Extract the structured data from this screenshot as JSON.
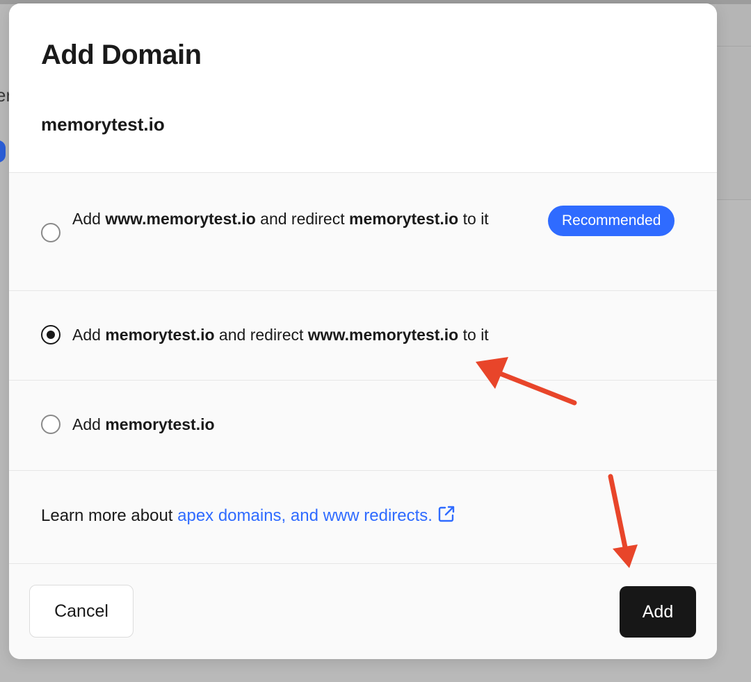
{
  "background": {
    "partial_text": "er"
  },
  "modal": {
    "title": "Add Domain",
    "domain": "memorytest.io"
  },
  "options": [
    {
      "selected": false,
      "parts": [
        {
          "text": "Add ",
          "bold": false
        },
        {
          "text": "www.memorytest.io",
          "bold": true
        },
        {
          "text": " and redirect ",
          "bold": false
        },
        {
          "text": "memorytest.io",
          "bold": true
        },
        {
          "text": " to it",
          "bold": false
        }
      ],
      "badge": "Recommended"
    },
    {
      "selected": true,
      "parts": [
        {
          "text": "Add ",
          "bold": false
        },
        {
          "text": "memorytest.io",
          "bold": true
        },
        {
          "text": " and redirect ",
          "bold": false
        },
        {
          "text": "www.memorytest.io",
          "bold": true
        },
        {
          "text": " to it",
          "bold": false
        }
      ]
    },
    {
      "selected": false,
      "parts": [
        {
          "text": "Add ",
          "bold": false
        },
        {
          "text": "memorytest.io",
          "bold": true
        }
      ]
    }
  ],
  "learn_more": {
    "prefix": "Learn more about ",
    "link_text": "apex domains, and www redirects.",
    "icon": "external-link-icon"
  },
  "footer": {
    "cancel_label": "Cancel",
    "add_label": "Add"
  },
  "colors": {
    "accent": "#2f6bff",
    "primary_button": "#171717",
    "annotation_arrow": "#e8452a"
  }
}
